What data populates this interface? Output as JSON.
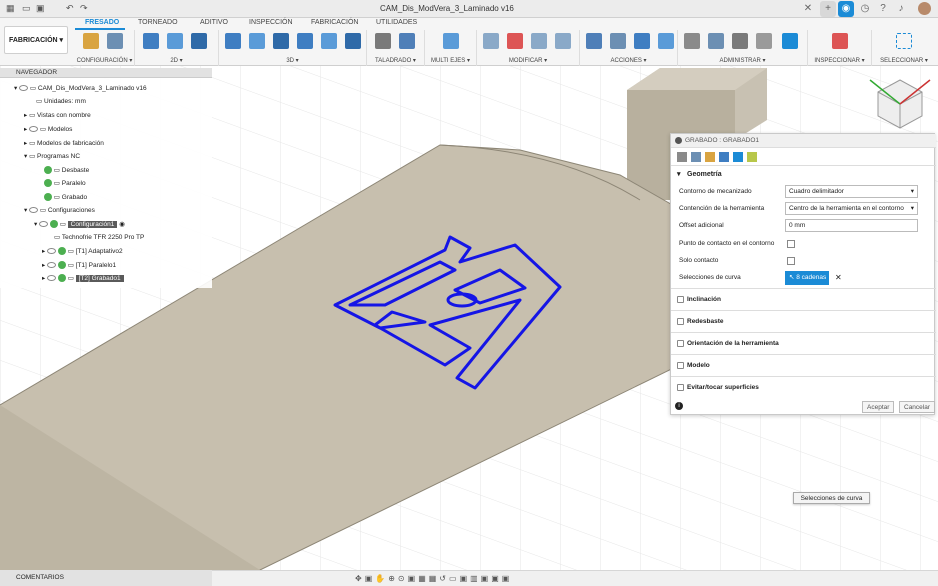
{
  "window": {
    "title": "CAM_Dis_ModVera_3_Laminado v16"
  },
  "workspace": {
    "label": "FABRICACIÓN ▾"
  },
  "tabs": [
    "FRESADO",
    "TORNEADO",
    "ADITIVO",
    "INSPECCIÓN",
    "FABRICACIÓN",
    "UTILIDADES"
  ],
  "groups": {
    "configuracion": "CONFIGURACIÓN ▾",
    "g2d": "2D ▾",
    "g3d": "3D ▾",
    "taladrado": "TALADRADO ▾",
    "multiejes": "MULTI EJES ▾",
    "modificar": "MODIFICAR ▾",
    "acciones": "ACCIONES ▾",
    "administrar": "ADMINISTRAR ▾",
    "inspeccionar": "INSPECCIONAR ▾",
    "seleccionar": "SELECCIONAR ▾"
  },
  "navigator": {
    "header": "NAVEGADOR",
    "root": "CAM_Dis_ModVera_3_Laminado v16",
    "units": "Unidades: mm",
    "named_views": "Vistas con nombre",
    "models": "Modelos",
    "fab_models": "Modelos de fabricación",
    "nc_programs": "Programas NC",
    "nc1": "Desbaste",
    "nc2": "Paralelo",
    "nc3": "Grabado",
    "setups": "Configuraciones",
    "setup1": "Configuración1",
    "machine": "Technofrie TFR 2250 Pro TP",
    "op1": "[T1] Adaptativo2",
    "op2": "[T1] Paralelo1",
    "op3": "[T2] Grabado1"
  },
  "dialog": {
    "title": "GRABADO : GRABADO1",
    "geometry_section": "Geometría",
    "machining_boundary_label": "Contorno de mecanizado",
    "machining_boundary_value": "Cuadro delimitador",
    "tool_containment_label": "Contención de la herramienta",
    "tool_containment_value": "Centro de la herramienta en el contorno",
    "offset_label": "Offset adicional",
    "offset_value": "0 mm",
    "contact_point_label": "Punto de contacto en el contorno",
    "only_contact_label": "Solo contacto",
    "curve_sel_label": "Selecciones de curva",
    "curve_sel_value": "8 cadenas",
    "inclination": "Inclinación",
    "rough": "Redesbaste",
    "tool_orientation": "Orientación de la herramienta",
    "model": "Modelo",
    "avoid": "Evitar/tocar superficies",
    "accept": "Aceptar",
    "cancel": "Cancelar"
  },
  "comments": "COMENTARIOS",
  "tooltip": "Selecciones de curva",
  "colors": {
    "accent": "#1b8bd6",
    "engrave": "#1515e6",
    "stock": "#c7bfae"
  }
}
